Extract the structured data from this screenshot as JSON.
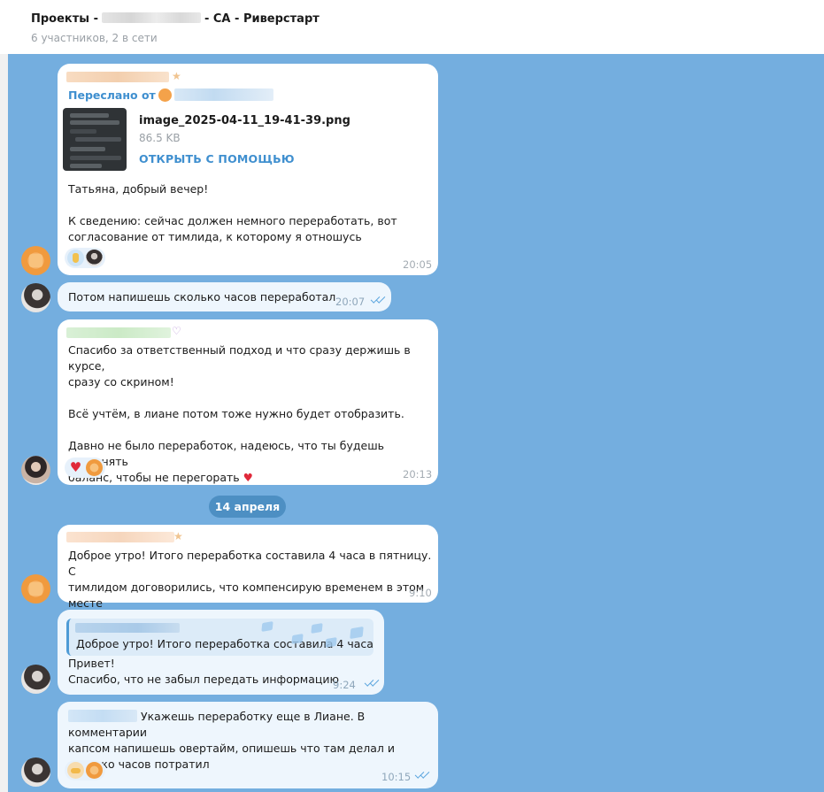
{
  "header": {
    "title_prefix": "Проекты -",
    "title_suffix": "- СА - Риверстарт",
    "subtitle": "6 участников, 2 в сети"
  },
  "messages": [
    {
      "forwarded_label": "Переслано от",
      "file": {
        "name": "image_2025-04-11_19-41-39.png",
        "size": "86.5 KB",
        "action": "ОТКРЫТЬ С ПОМОЩЬЮ"
      },
      "text": "Татьяна, добрый вечер!\n\nК сведению: сейчас должен немного переработать, вот\nсогласование от тимлида, к которому я отношусь",
      "time": "20:05"
    },
    {
      "text": "Потом напишешь сколько часов переработал",
      "time": "20:07"
    },
    {
      "text": "Спасибо за ответственный подход и что сразу держишь в курсе,\nсразу со скрином!\n\nВсё учтём, в лиане потом тоже нужно будет отобразить.\n\nДавно не было переработок, надеюсь, что ты будешь сохранять\nбаланс, чтобы не перегорать",
      "time": "20:13"
    },
    {
      "text": "Доброе утро! Итого переработка составила 4 часа в пятницу. С\nтимлидом договорились, что компенсирую временем в этом\nместе",
      "time": "9:10"
    },
    {
      "reply_text": "Доброе утро! Итого переработка составила 4 часа ...",
      "text": "Привет!\nСпасибо, что не забыл передать информацию",
      "time": "9:24"
    },
    {
      "text_line1": "Укажешь переработку еще в Лиане. В комментарии",
      "text_rest": "капсом напишешь овертайм, опишешь что там делал  и\nсколько часов потратил",
      "time": "10:15"
    }
  ],
  "date_separator": "14 апреля"
}
